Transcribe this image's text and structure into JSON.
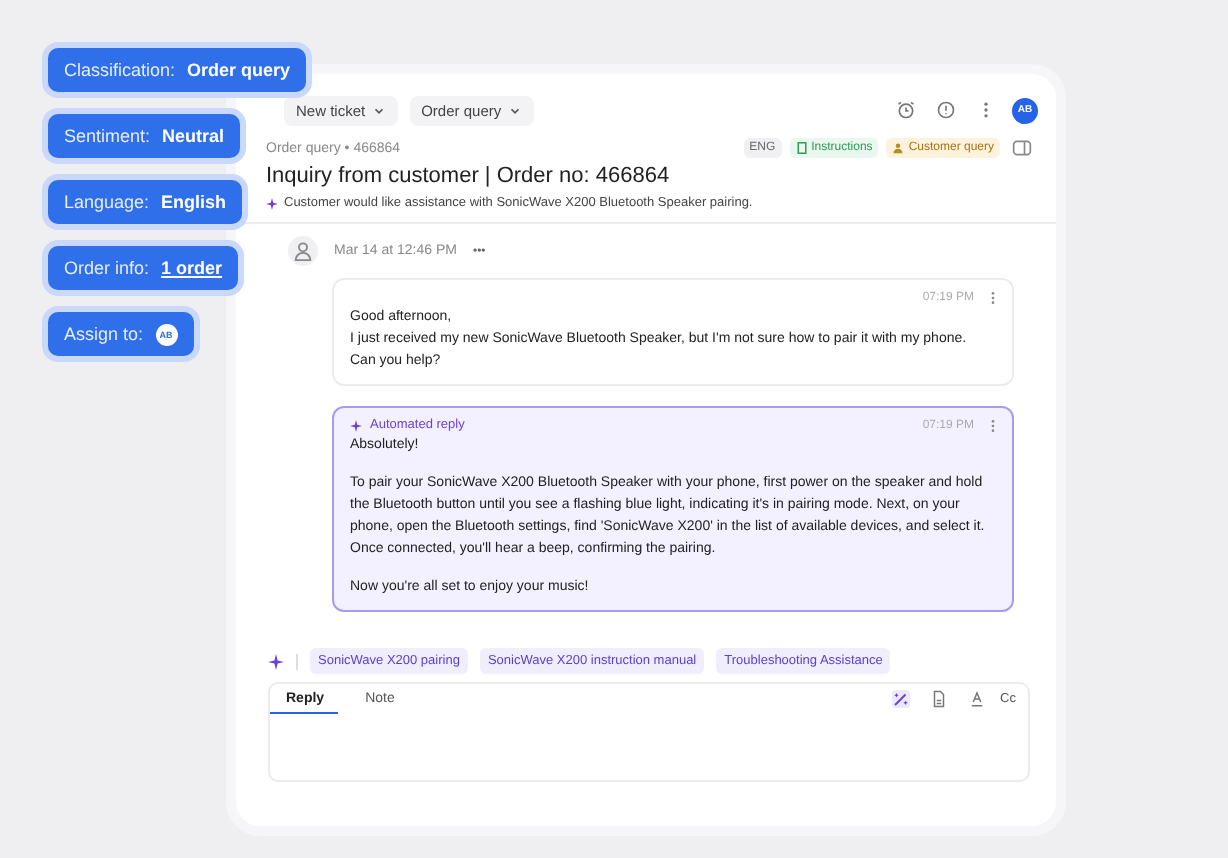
{
  "ai_tags": [
    {
      "kind": "text",
      "label": "Classification:",
      "value": "Order query"
    },
    {
      "kind": "text",
      "label": "Sentiment:",
      "value": "Neutral"
    },
    {
      "kind": "text",
      "label": "Language:",
      "value": "English"
    },
    {
      "kind": "link",
      "label": "Order info:",
      "value": "1 order"
    },
    {
      "kind": "avatar",
      "label": "Assign to:",
      "value": "AB"
    }
  ],
  "toolbar": {
    "dropdowns": [
      "New ticket",
      "Order query"
    ],
    "avatar": "AB"
  },
  "ticket": {
    "breadcrumb": [
      "Order query",
      "466864"
    ],
    "breadcrumb_separator": "•",
    "badges": [
      {
        "kind": "lang",
        "label": "ENG"
      },
      {
        "kind": "doc",
        "label": "Instructions"
      },
      {
        "kind": "person",
        "label": "Customer query"
      }
    ],
    "title": "Inquiry from customer | Order no: 466864",
    "summary": "Customer would like assistance with SonicWave X200 Bluetooth Speaker pairing."
  },
  "thread": {
    "timestamp": "Mar 14 at 12:46 PM",
    "more": "•••"
  },
  "messages": [
    {
      "kind": "customer",
      "time": "07:19 PM",
      "paragraphs": [
        "Good afternoon,\nI just received my new SonicWave Bluetooth Speaker, but I'm not sure how to pair it with my phone.\nCan you help?"
      ]
    },
    {
      "kind": "automated",
      "label": "Automated reply",
      "time": "07:19 PM",
      "paragraphs": [
        "Absolutely!",
        "To pair your SonicWave X200 Bluetooth Speaker with your phone, first power on the speaker and hold the Bluetooth button until you see a flashing blue light, indicating it's in pairing mode. Next, on your phone, open the Bluetooth settings, find 'SonicWave X200' in the list of available devices, and select it. Once connected, you'll hear a beep, confirming the pairing.",
        "Now you're all set to enjoy your music!"
      ]
    }
  ],
  "suggestions": [
    "SonicWave X200 pairing",
    "SonicWave X200 instruction manual",
    "Troubleshooting Assistance"
  ],
  "editor": {
    "tabs": [
      {
        "label": "Reply",
        "selected": true
      },
      {
        "label": "Note",
        "selected": false
      }
    ],
    "cc": "Cc"
  }
}
